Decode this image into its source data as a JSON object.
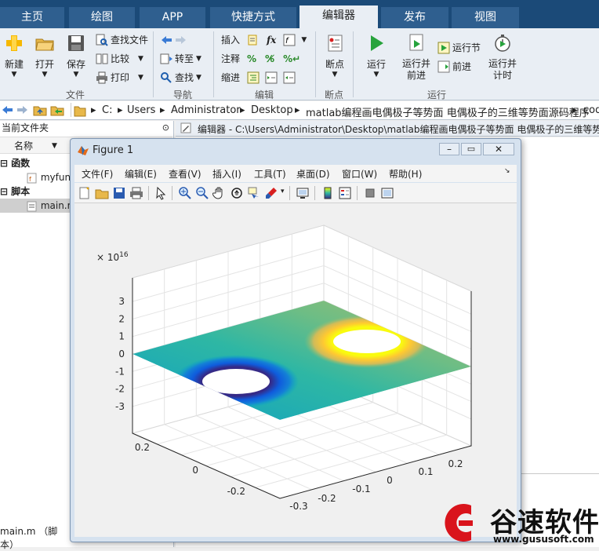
{
  "ribbon": {
    "tabs": [
      "主页",
      "绘图",
      "APP",
      "快捷方式",
      "编辑器",
      "发布",
      "视图"
    ],
    "active_tab": "编辑器",
    "file_group": {
      "label": "文件",
      "new": "新建",
      "open": "打开",
      "save": "保存",
      "find_files": "查找文件",
      "compare": "比较",
      "print": "打印"
    },
    "nav_group": {
      "label": "导航",
      "goto": "转至",
      "find": "查找"
    },
    "edit_group": {
      "label": "编辑",
      "insert": "插入",
      "comment": "注释",
      "indent": "缩进",
      "fx": "fx"
    },
    "breakpoint_group": {
      "label": "断点",
      "breakpoints": "断点"
    },
    "run_group": {
      "label": "运行",
      "run": "运行",
      "run_advance": "运行并\n前进",
      "run_section": "运行节",
      "advance": "前进",
      "run_time": "运行并\n计时"
    }
  },
  "address": {
    "drive": "C:",
    "parts": [
      "Users",
      "Administrator",
      "Desktop",
      "matlab编程画电偶极子等势面 电偶极子的三维等势面源码程序",
      "cod"
    ]
  },
  "left_panel": {
    "header": "当前文件夹",
    "column": "名称",
    "group1": "函数",
    "item1": "myfun",
    "group2": "脚本",
    "item2": "main.m",
    "status": "main.m （脚本）"
  },
  "editor": {
    "title": "编辑器 - C:\\Users\\Administrator\\Desktop\\matlab编程画电偶极子等势面 电偶极子的三维等势"
  },
  "figure": {
    "title": "Figure 1",
    "menus": [
      "文件(F)",
      "编辑(E)",
      "查看(V)",
      "插入(I)",
      "工具(T)",
      "桌面(D)",
      "窗口(W)",
      "帮助(H)"
    ]
  },
  "chart_data": {
    "type": "surface",
    "exponent_label": "× 10",
    "exponent": "16",
    "z_ticks": [
      "3",
      "2",
      "1",
      "0",
      "-1",
      "-2",
      "-3"
    ],
    "zlim": [
      -3.5,
      3.5
    ],
    "y_ticks": [
      "0.2",
      "0",
      "-0.2"
    ],
    "x_ticks": [
      "0.2",
      "0.1",
      "0",
      "-0.1",
      "-0.2",
      "-0.3"
    ],
    "description_series": [
      {
        "name": "",
        "feature": "negative charge hole",
        "value_sign": -1
      },
      {
        "name": "",
        "feature": "positive charge hole",
        "value_sign": 1
      }
    ],
    "colormap": [
      "#352a87",
      "#0f5cdd",
      "#1481d6",
      "#06a4ca",
      "#2eb7a4",
      "#87bf77",
      "#d1bb59",
      "#fec832",
      "#f9fb0e"
    ]
  },
  "watermark": {
    "brand": "谷速软件",
    "url": "www.gususoft.com"
  }
}
